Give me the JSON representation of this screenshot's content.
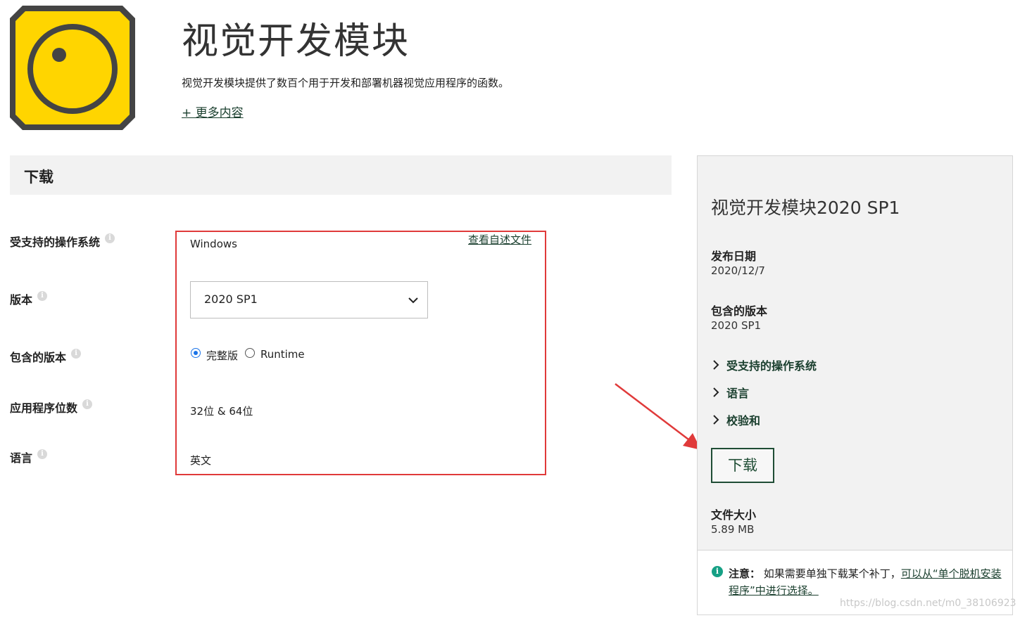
{
  "header": {
    "title": "视觉开发模块",
    "description": "视觉开发模块提供了数百个用于开发和部署机器视觉应用程序的函数。",
    "more_link": "+ 更多内容"
  },
  "download_section": {
    "title": "下载",
    "labels": {
      "os": "受支持的操作系统",
      "version": "版本",
      "included_edition": "包含的版本",
      "bitness": "应用程序位数",
      "language": "语言"
    },
    "os_value": "Windows",
    "readme_link": "查看自述文件",
    "version_select": "2020 SP1",
    "edition_options": [
      {
        "label": "完整版",
        "checked": true
      },
      {
        "label": "Runtime",
        "checked": false
      }
    ],
    "bitness_value": "32位 & 64位",
    "language_value": "英文"
  },
  "panel": {
    "title": "视觉开发模块2020 SP1",
    "release_date_label": "发布日期",
    "release_date": "2020/12/7",
    "included_edition_label": "包含的版本",
    "included_edition": "2020 SP1",
    "expanders": [
      "受支持的操作系统",
      "语言",
      "校验和"
    ],
    "download_button": "下载",
    "file_size_label": "文件大小",
    "file_size": "5.89 MB"
  },
  "notice": {
    "label": "注意：",
    "text": "如果需要单独下载某个补丁，",
    "link": "可以从“单个脱机安装程序”中进行选择。"
  },
  "watermark": "https://blog.csdn.net/m0_38106923",
  "colors": {
    "highlight_box": "#e03a3a",
    "arrow": "#e03a3a",
    "brand_green": "#1f4d35",
    "logo_yellow": "#ffd500",
    "radio_blue": "#1a73e8"
  }
}
